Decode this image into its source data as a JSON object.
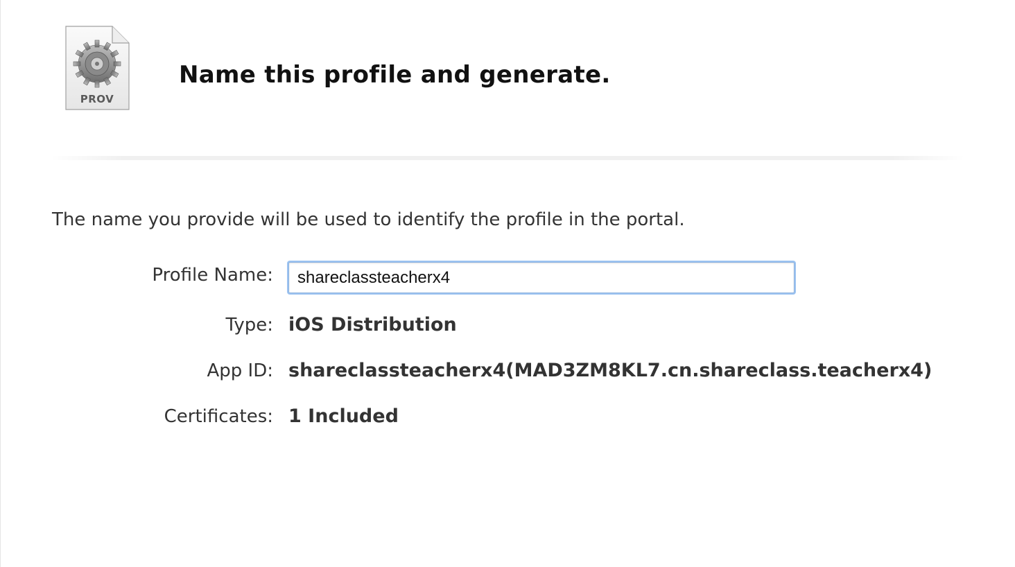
{
  "header": {
    "icon_label": "PROV",
    "title": "Name this profile and generate."
  },
  "form": {
    "description": "The name you provide will be used to identify the profile in the portal.",
    "profile_name": {
      "label": "Profile Name:",
      "value": "shareclassteacherx4"
    },
    "type": {
      "label": "Type:",
      "value": "iOS Distribution"
    },
    "app_id": {
      "label": "App ID:",
      "value": "shareclassteacherx4(MAD3ZM8KL7.cn.shareclass.teacherx4)"
    },
    "certificates": {
      "label": "Certificates:",
      "value": "1 Included"
    }
  },
  "icons": {
    "provisioning_profile": "gear-document-icon"
  },
  "colors": {
    "input_focus": "#9cc3f1",
    "text": "#333333",
    "title": "#111111"
  }
}
